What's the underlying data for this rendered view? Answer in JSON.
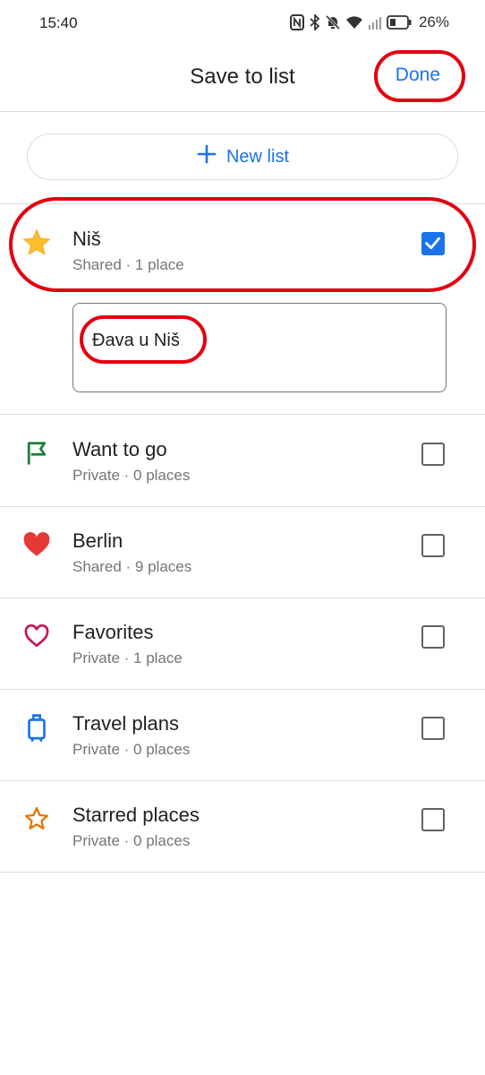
{
  "status_bar": {
    "time": "15:40",
    "battery": "26%"
  },
  "header": {
    "title": "Save to list",
    "done_label": "Done"
  },
  "new_list": {
    "label": "New list"
  },
  "lists": [
    {
      "name": "Niš",
      "meta": "Shared · 1 place",
      "checked": true,
      "icon": "star-filled-icon",
      "icon_color": "#fbc02d",
      "note": "Đava u Niš"
    },
    {
      "name": "Want to go",
      "meta": "Private · 0 places",
      "checked": false,
      "icon": "flag-icon",
      "icon_color": "#188038"
    },
    {
      "name": "Berlin",
      "meta": "Shared · 9 places",
      "checked": false,
      "icon": "heart-filled-icon",
      "icon_color": "#e53935"
    },
    {
      "name": "Favorites",
      "meta": "Private · 1 place",
      "checked": false,
      "icon": "heart-outline-icon",
      "icon_color": "#c2185b"
    },
    {
      "name": "Travel plans",
      "meta": "Private · 0 places",
      "checked": false,
      "icon": "suitcase-icon",
      "icon_color": "#1a73e8"
    },
    {
      "name": "Starred places",
      "meta": "Private · 0 places",
      "checked": false,
      "icon": "star-outline-icon",
      "icon_color": "#e37400"
    }
  ],
  "colors": {
    "accent": "#1a73e8",
    "highlight_ring": "#e3000f",
    "divider": "#dadce0"
  }
}
